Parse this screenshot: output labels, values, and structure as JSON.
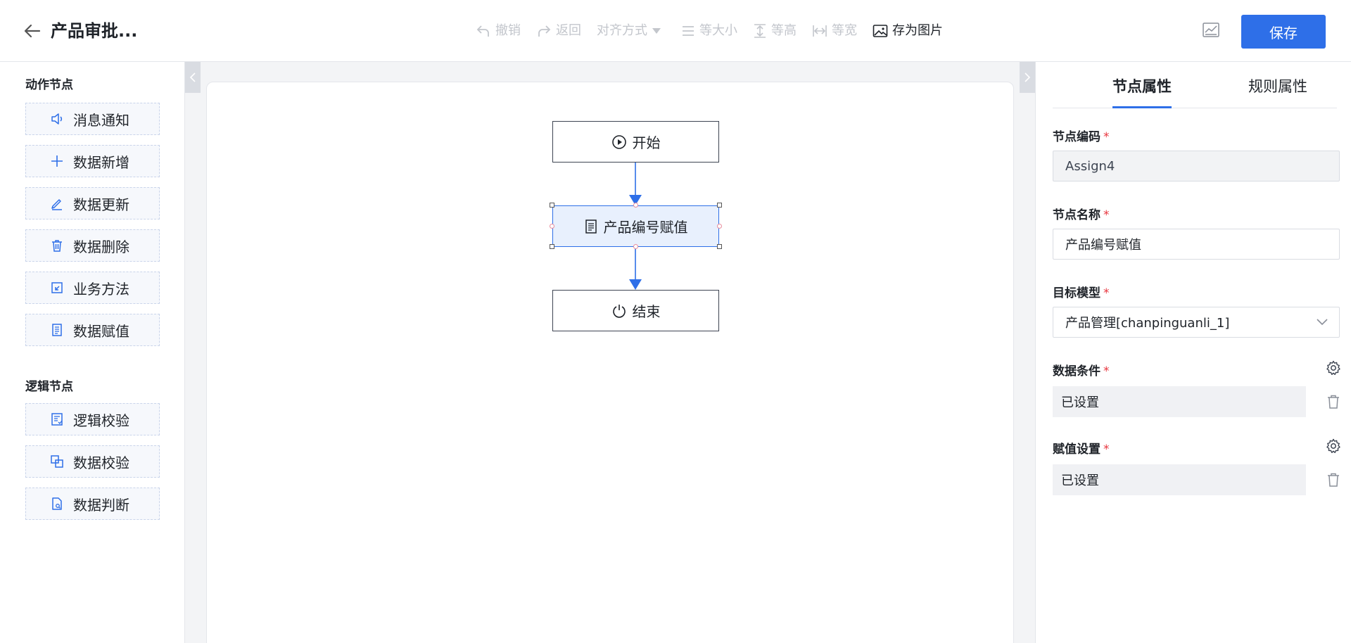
{
  "header": {
    "title": "产品审批...",
    "toolbar": {
      "undo": "撤销",
      "redo": "返回",
      "align": "对齐方式",
      "same_size": "等大小",
      "same_height": "等高",
      "same_width": "等宽",
      "save_image": "存为图片"
    },
    "save_label": "保存"
  },
  "palette": {
    "action_title": "动作节点",
    "action_items": [
      "消息通知",
      "数据新增",
      "数据更新",
      "数据删除",
      "业务方法",
      "数据赋值"
    ],
    "logic_title": "逻辑节点",
    "logic_items": [
      "逻辑校验",
      "数据校验",
      "数据判断"
    ]
  },
  "flow": {
    "start": "开始",
    "assign": "产品编号赋值",
    "end": "结束"
  },
  "properties": {
    "tabs": [
      "节点属性",
      "规则属性"
    ],
    "node_code_label": "节点编码",
    "node_code_value": "Assign4",
    "node_name_label": "节点名称",
    "node_name_value": "产品编号赋值",
    "target_model_label": "目标模型",
    "target_model_value": "产品管理[chanpinguanli_1]",
    "data_condition_label": "数据条件",
    "data_condition_value": "已设置",
    "assign_setting_label": "赋值设置",
    "assign_setting_value": "已设置",
    "required_mark": "*"
  },
  "colors": {
    "primary": "#2e6fe8",
    "required": "#e8363f",
    "selected_fill": "#e8f0fd"
  }
}
